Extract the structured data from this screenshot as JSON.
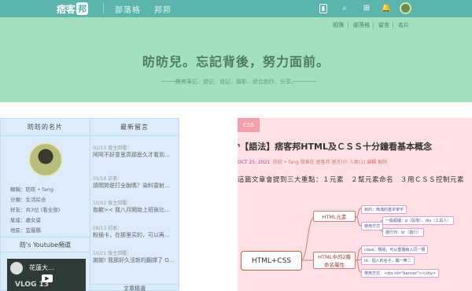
{
  "topbar": {
    "logo_text": "痞客",
    "logo_mark": "邦",
    "nav": [
      "部落格",
      "邦邦"
    ],
    "icons": [
      "bookmark-icon",
      "search-icon",
      "grid-icon",
      "bell-icon",
      "avatar"
    ]
  },
  "subnav": {
    "items": [
      "相簿",
      "部落格",
      "留言",
      "名片"
    ]
  },
  "banner": {
    "title": "昉昉兒。忘記背後，努力面前。",
    "subtitle": "教育筆記．遊記．食記．攝影．綜合創作．分享。"
  },
  "profile": {
    "heading": "昉昉的名片",
    "lines": [
      "暱稱：昉昉 • fang",
      "分類：生活綜合",
      "好友：共3位 (看全部)",
      "星座：處女座",
      "地區：宜蘭縣"
    ]
  },
  "youtube": {
    "heading": "昉's Youtube頻道",
    "video_title": "花蓮大…",
    "video_caption": "VLOG 13"
  },
  "comments": {
    "heading": "最新留言",
    "items": [
      {
        "meta": "02/15 版主回覆：",
        "text": "阿阿不好意思高那麼久才看到…"
      },
      {
        "meta": "05/16 訪客：",
        "text": "請問妳是打全脫嗎？染料雷射…"
      },
      {
        "meta": "10/02 版主回覆：",
        "text": "抱歉>< 我八月開始上班後比…"
      },
      {
        "meta": "08/13 訪客：",
        "text": "粉插卡，在那里买的，可以再…"
      },
      {
        "meta": "10/21 版主回覆：",
        "text": "謝謝! 我那好久沒新的翻譯了 Q…"
      }
    ],
    "bottom_heading": "文章精選"
  },
  "post": {
    "tag": "CSS",
    "title": "ᵐ【語法】痞客邦HTML及ＣＳＳ十分鐘看基本概念",
    "meta_date": "OCT 25, 2021",
    "meta_rest": "昉昉 • fang 發表在 痞客邦   留言(0)   人氣(1)   編輯   刪除",
    "intro": "這篇文章會提到三大重點：１元素　２幫元素命名　３用ＣＳＳ控制元素",
    "mindmap": {
      "root": "HTML+CSS",
      "branches": [
        "HTML元素",
        "HTML中的2種\n命名屬性"
      ],
      "leaves": [
        "目的：佈滿的基本架字",
        "使用方式",
        "一般超鏈：p（段落）、div（工具人）",
        "擔行你：br（換行）",
        "class：類組，可以重複納入同一類",
        "id：個人的名子，獨一無二",
        "使用方式：<div id=\"banner\"></div>"
      ]
    }
  }
}
